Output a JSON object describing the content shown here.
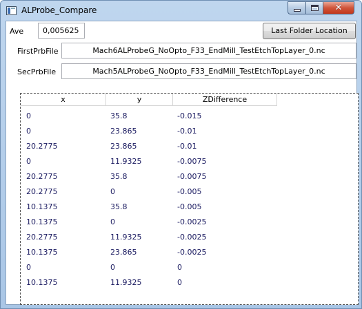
{
  "window": {
    "title": "ALProbe_Compare",
    "icon": "app-window-icon",
    "controls": {
      "minimize": "minimize-icon",
      "maximize": "maximize-icon",
      "close": "close-icon",
      "close_glyph": "✕"
    }
  },
  "ave": {
    "label": "Ave",
    "value": "0,005625"
  },
  "folder_button": {
    "label": "Last Folder Location"
  },
  "first_prb": {
    "label": "FirstPrbFile",
    "value": "Mach6ALProbeG_NoOpto_F33_EndMill_TestEtchTopLayer_0.nc"
  },
  "sec_prb": {
    "label": "SecPrbFile",
    "value": "Mach5ALProbeG_NoOpto_F33_EndMill_TestEtchTopLayer_0.nc"
  },
  "grid": {
    "columns": [
      "x",
      "y",
      "ZDifference"
    ],
    "rows": [
      [
        "0",
        "35.8",
        "-0.015"
      ],
      [
        "0",
        "23.865",
        "-0.01"
      ],
      [
        "20.2775",
        "23.865",
        "-0.01"
      ],
      [
        "0",
        "11.9325",
        "-0.0075"
      ],
      [
        "20.2775",
        "35.8",
        "-0.0075"
      ],
      [
        "20.2775",
        "0",
        "-0.005"
      ],
      [
        "10.1375",
        "35.8",
        "-0.005"
      ],
      [
        "10.1375",
        "0",
        "-0.0025"
      ],
      [
        "20.2775",
        "11.9325",
        "-0.0025"
      ],
      [
        "10.1375",
        "23.865",
        "-0.0025"
      ],
      [
        "0",
        "0",
        "0"
      ],
      [
        "10.1375",
        "11.9325",
        "0"
      ]
    ]
  }
}
